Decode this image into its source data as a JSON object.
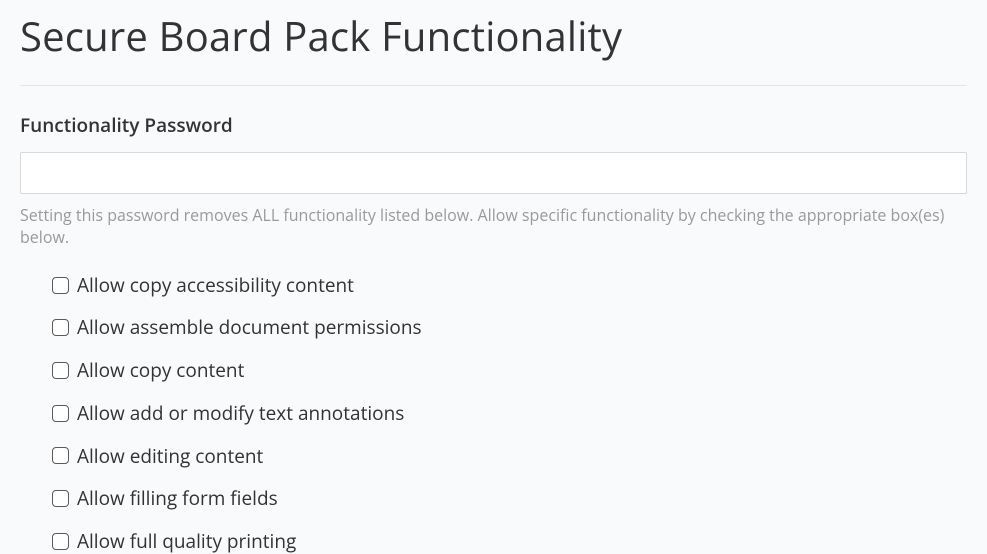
{
  "page": {
    "title": "Secure Board Pack Functionality"
  },
  "password_field": {
    "label": "Functionality Password",
    "value": "",
    "help_text": "Setting this password removes ALL functionality listed below. Allow specific functionality by checking the appropriate box(es) below."
  },
  "options": [
    {
      "id": "allow-copy-accessibility",
      "label": "Allow copy accessibility content",
      "checked": false
    },
    {
      "id": "allow-assemble-document",
      "label": "Allow assemble document permissions",
      "checked": false
    },
    {
      "id": "allow-copy-content",
      "label": "Allow copy content",
      "checked": false
    },
    {
      "id": "allow-modify-annotations",
      "label": "Allow add or modify text annotations",
      "checked": false
    },
    {
      "id": "allow-editing-content",
      "label": "Allow editing content",
      "checked": false
    },
    {
      "id": "allow-filling-form-fields",
      "label": "Allow filling form fields",
      "checked": false
    },
    {
      "id": "allow-full-quality-printing",
      "label": "Allow full quality printing",
      "checked": false
    }
  ]
}
